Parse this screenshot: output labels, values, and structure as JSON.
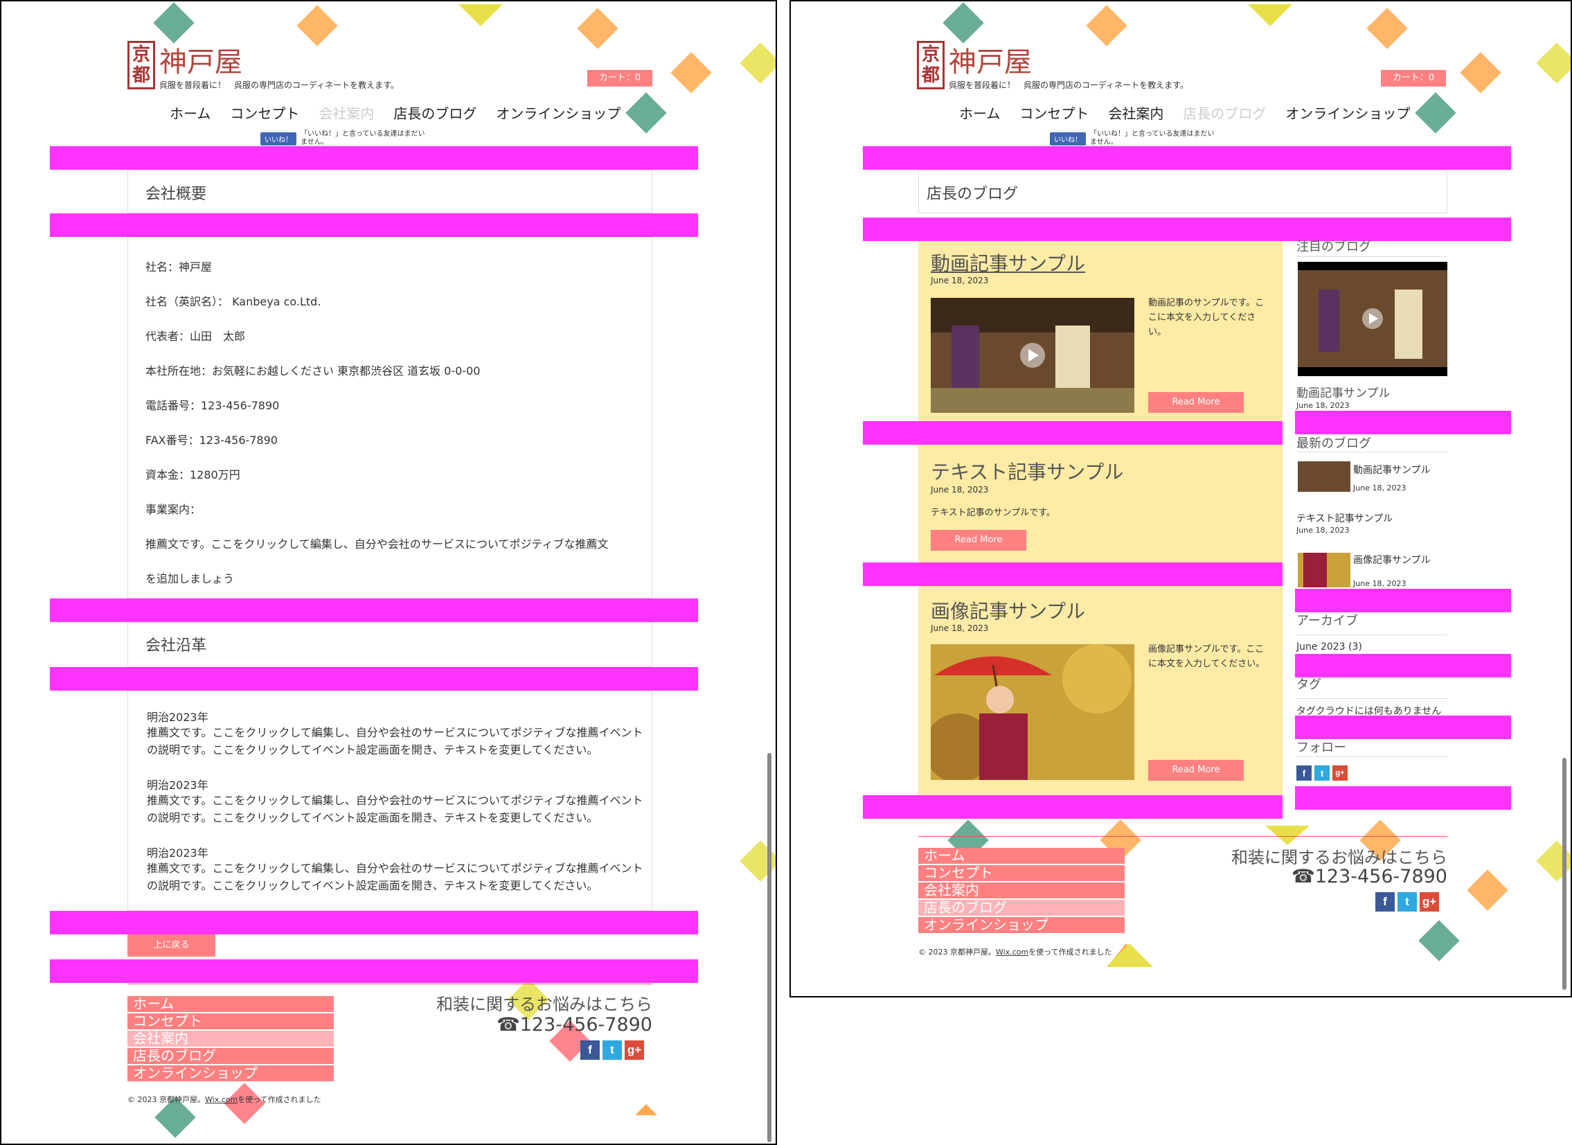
{
  "brand": {
    "logo_glyph": "京都",
    "name": "神戸屋",
    "tagline": "呉服を普段着に！　呉服の専門店のコーディネートを教えます。",
    "cart": "カート：0"
  },
  "nav": [
    "ホーム",
    "コンセプト",
    "会社案内",
    "店長のブログ",
    "オンラインショップ"
  ],
  "facebook": {
    "button": "いいね！",
    "text": "「いいね！」と言っている友達はまだいません。"
  },
  "left_page": {
    "overview_title": "会社概要",
    "overview_lines": [
      "社名：神戸屋",
      "社名（英訳名）：  Kanbeya co.Ltd.",
      "代表者：山田　太郎",
      "本社所在地：お気軽にお越しください 東京都渋谷区 道玄坂 0-0-00",
      "電話番号：123-456-7890",
      "FAX番号：123-456-7890",
      "資本金：1280万円",
      "事業案内：",
      "推薦文です。ここをクリックして編集し、自分や会社のサービスについてポジティブな推薦文",
      "を追加しましょう"
    ],
    "history_title": "会社沿革",
    "history": [
      {
        "year": "明治2023年",
        "text": "推薦文です。ここをクリックして編集し、自分や会社のサービスについてポジティブな推薦イベントの説明です。ここをクリックしてイベント設定画面を開き、テキストを変更してください。"
      },
      {
        "year": "明治2023年",
        "text": "推薦文です。ここをクリックして編集し、自分や会社のサービスについてポジティブな推薦イベントの説明です。ここをクリックしてイベント設定画面を開き、テキストを変更してください。"
      },
      {
        "year": "明治2023年",
        "text": "推薦文です。ここをクリックして編集し、自分や会社のサービスについてポジティブな推薦イベントの説明です。ここをクリックしてイベント設定画面を開き、テキストを変更してください。"
      }
    ],
    "back_to_top": "上に戻る"
  },
  "right_page": {
    "title": "店長のブログ",
    "posts": [
      {
        "title": "動画記事サンプル",
        "date": "June 18, 2023",
        "excerpt": "動画記事のサンプルです。ここに本文を入力してください。",
        "read_more": "Read More"
      },
      {
        "title": "テキスト記事サンプル",
        "date": "June 18, 2023",
        "excerpt": "テキスト記事のサンプルです。",
        "read_more": "Read More"
      },
      {
        "title": "画像記事サンプル",
        "date": "June 18, 2023",
        "excerpt": "画像記事サンプルです。ここに本文を入力してください。",
        "read_more": "Read More"
      }
    ],
    "sidebar": {
      "featured_title": "注目のブログ",
      "featured_post": "動画記事サンプル",
      "featured_date": "June 18, 2023",
      "recent_title": "最新のブログ",
      "recent": [
        {
          "title": "動画記事サンプル",
          "date": "June 18, 2023"
        },
        {
          "title": "テキスト記事サンプル",
          "date": "June 18, 2023"
        },
        {
          "title": "画像記事サンプル",
          "date": "June 18, 2023"
        }
      ],
      "archive_title": "アーカイブ",
      "archive_item": "June 2023 (3)",
      "tags_title": "タグ",
      "tags_empty": "タグクラウドには何もありません",
      "follow_title": "フォロー"
    }
  },
  "footer": {
    "menu": [
      "ホーム",
      "コンセプト",
      "会社案内",
      "店長のブログ",
      "オンラインショップ"
    ],
    "contact_title": "和装に関するお悩みはこちら",
    "phone": "123-456-7890",
    "copyright_prefix": "© 2023 京都神戸屋。",
    "copyright_link": "Wix.com",
    "copyright_suffix": "を使って作成されました"
  },
  "colors": {
    "accent": "#ff8080",
    "highlight": "#ff33ff",
    "brand": "#b3453a",
    "panel": "#fdeba6"
  }
}
